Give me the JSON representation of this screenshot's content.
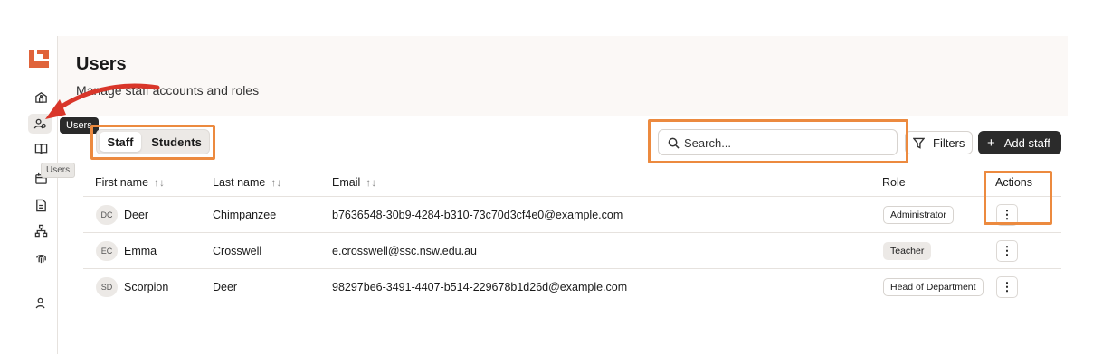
{
  "sidebar": {
    "tooltip_active": "Users",
    "tooltip_hover": "Users",
    "icons": [
      "school-icon",
      "users-icon",
      "book-icon",
      "calendar-icon",
      "document-icon",
      "org-chart-icon",
      "fingerprint-icon",
      "user-icon"
    ]
  },
  "header": {
    "title": "Users",
    "subtitle": "Manage staff accounts and roles"
  },
  "toolbar": {
    "tabs": [
      "Staff",
      "Students"
    ],
    "active_tab": "Staff",
    "search_placeholder": "Search...",
    "filters_label": "Filters",
    "add_label": "Add staff",
    "add_icon": "+"
  },
  "table": {
    "columns": [
      "First name",
      "Last name",
      "Email",
      "Role",
      "Actions"
    ],
    "sort_glyph": "↑↓",
    "rows": [
      {
        "initials": "DC",
        "first": "Deer",
        "last": "Chimpanzee",
        "email": "b7636548-30b9-4284-b310-73c70d3cf4e0@example.com",
        "role": "Administrator"
      },
      {
        "initials": "EC",
        "first": "Emma",
        "last": "Crosswell",
        "email": "e.crosswell@ssc.nsw.edu.au",
        "role": "Teacher"
      },
      {
        "initials": "SD",
        "first": "Scorpion",
        "last": "Deer",
        "email": "98297be6-3491-4407-b514-229678b1d26d@example.com",
        "role": "Head of Department"
      }
    ],
    "kebab_glyph": "⋮"
  },
  "colors": {
    "brand": "#e0633a",
    "highlight": "#ec8a3f",
    "arrow": "#d9362a",
    "primary_button": "#2b2b2b"
  }
}
